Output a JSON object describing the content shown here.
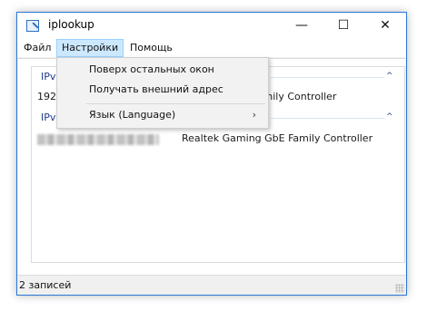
{
  "window": {
    "title": "iplookup",
    "controls": {
      "minimize": "—",
      "maximize": "☐",
      "close": "✕"
    }
  },
  "menubar": {
    "items": [
      "Файл",
      "Настройки",
      "Помощь"
    ],
    "active_index": 1
  },
  "dropdown": {
    "items": [
      {
        "label": "Поверх остальных окон",
        "submenu": false
      },
      {
        "label": "Получать внешний адрес",
        "submenu": false
      },
      {
        "label": "Язык (Language)",
        "submenu": true,
        "arrow": "›"
      }
    ]
  },
  "groups": [
    {
      "header": "IPv",
      "left_value": "192.",
      "right_value": "E Family Controller"
    },
    {
      "header": "IPv",
      "left_value": "",
      "right_value": "Realtek Gaming GbE Family Controller"
    }
  ],
  "group_chevron": "^",
  "statusbar": {
    "text": "2 записей"
  },
  "icons": [
    "app-icon",
    "chevron-up-icon",
    "submenu-arrow-icon",
    "resize-grip-icon"
  ],
  "colors": {
    "accent": "#2b78d6",
    "menu_active": "#cce8ff",
    "group_header": "#1e3a8a"
  }
}
